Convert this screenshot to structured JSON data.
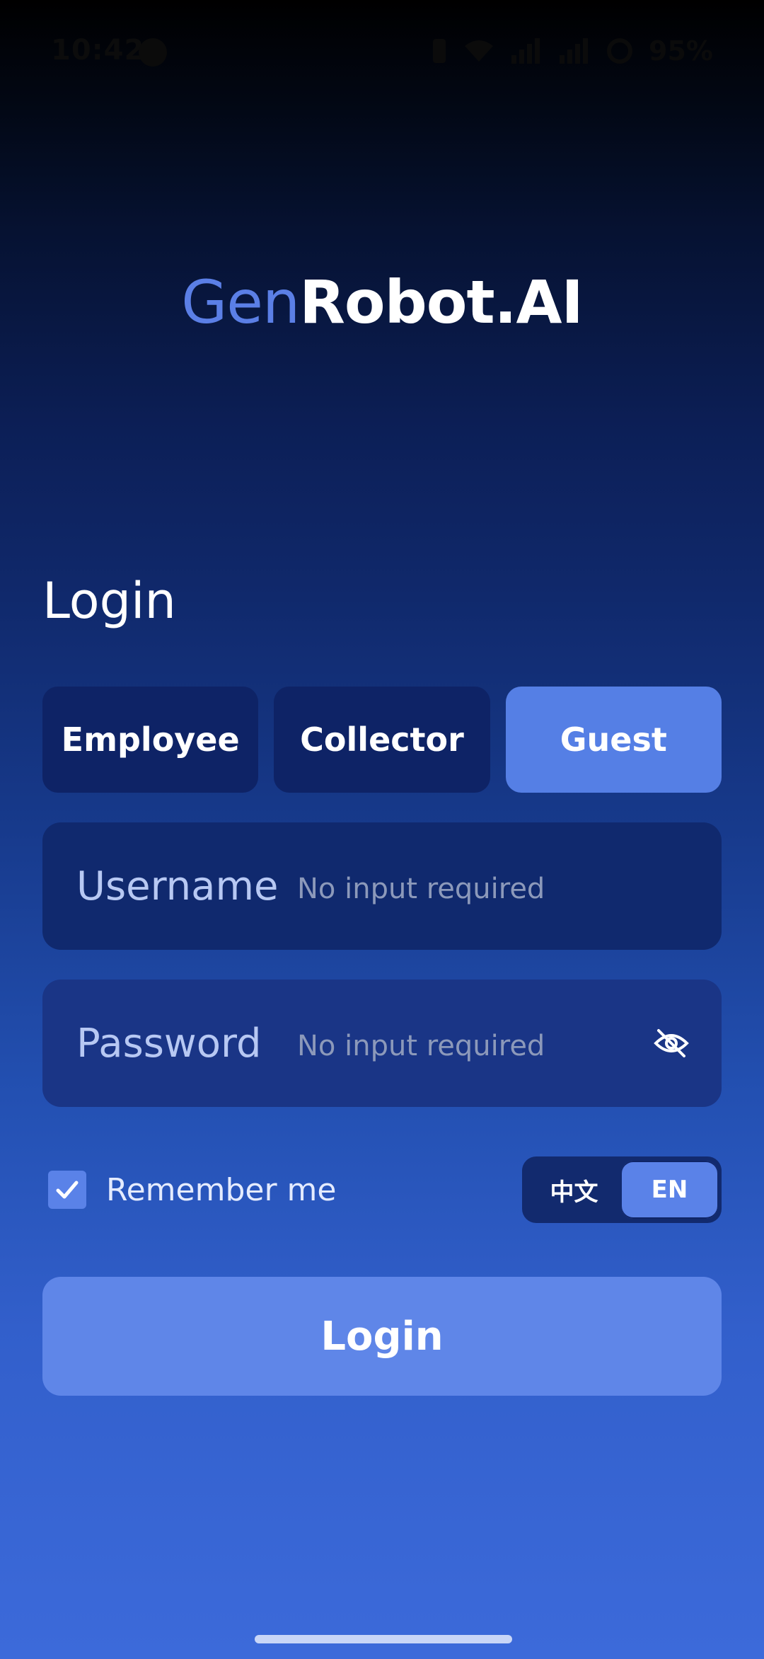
{
  "status_bar": {
    "time": "10:42",
    "battery": "95%"
  },
  "brand": {
    "prefix": "Gen",
    "suffix": "Robot.AI",
    "prefix_color": "#5b7fe6",
    "suffix_color": "#ffffff"
  },
  "login": {
    "heading": "Login",
    "roles": [
      {
        "label": "Employee",
        "active": false
      },
      {
        "label": "Collector",
        "active": false
      },
      {
        "label": "Guest",
        "active": true
      }
    ],
    "username": {
      "label": "Username",
      "placeholder": "No input required",
      "value": ""
    },
    "password": {
      "label": "Password",
      "placeholder": "No input required",
      "value": "",
      "visibility_icon": "eye-off-icon"
    },
    "remember": {
      "label": "Remember me",
      "checked": true
    },
    "language": {
      "options": [
        "中文",
        "EN"
      ],
      "selected": "EN"
    },
    "submit_label": "Login"
  },
  "colors": {
    "accent": "#557fe5",
    "tab_bg": "#0e2366",
    "field_bg": "#11296e",
    "button": "#5f86e8"
  }
}
